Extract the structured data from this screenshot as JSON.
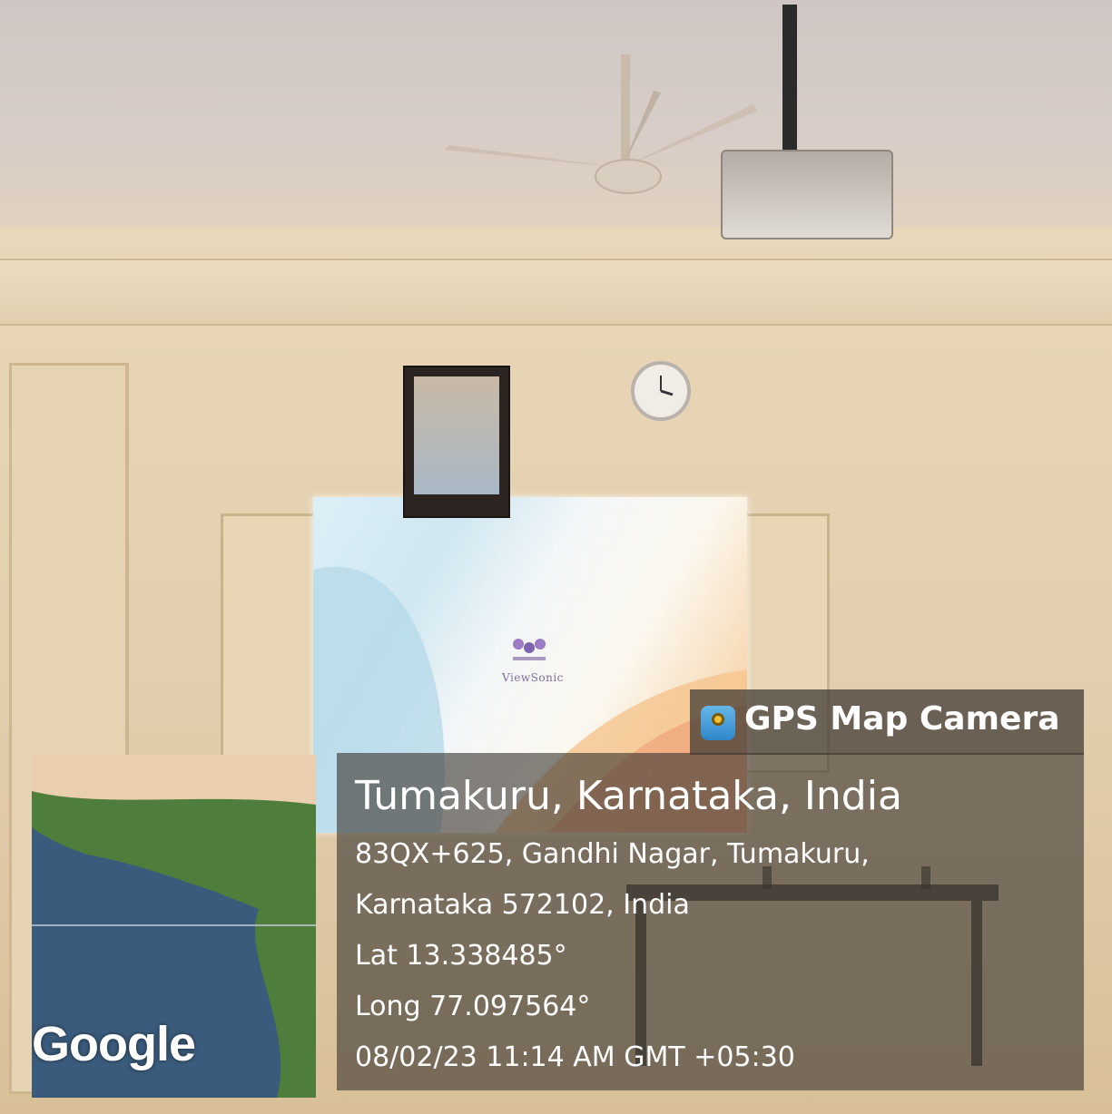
{
  "overlay": {
    "app_name": "GPS Map Camera",
    "app_icon": "map-pin-icon",
    "location_title": "Tumakuru, Karnataka, India",
    "address_line1": "83QX+625, Gandhi Nagar, Tumakuru,",
    "address_line2": "Karnataka 572102, India",
    "latitude": "Lat 13.338485°",
    "longitude": "Long 77.097564°",
    "timestamp": "08/02/23 11:14 AM GMT +05:30"
  },
  "map_thumbnail": {
    "attribution": "Google"
  },
  "projector_screen": {
    "brand": "ViewSonic"
  },
  "colors": {
    "overlay_bg": "#3c3732",
    "text": "#ffffff",
    "map_water": "#3a5b7c",
    "map_land": "#4f7d3c"
  }
}
